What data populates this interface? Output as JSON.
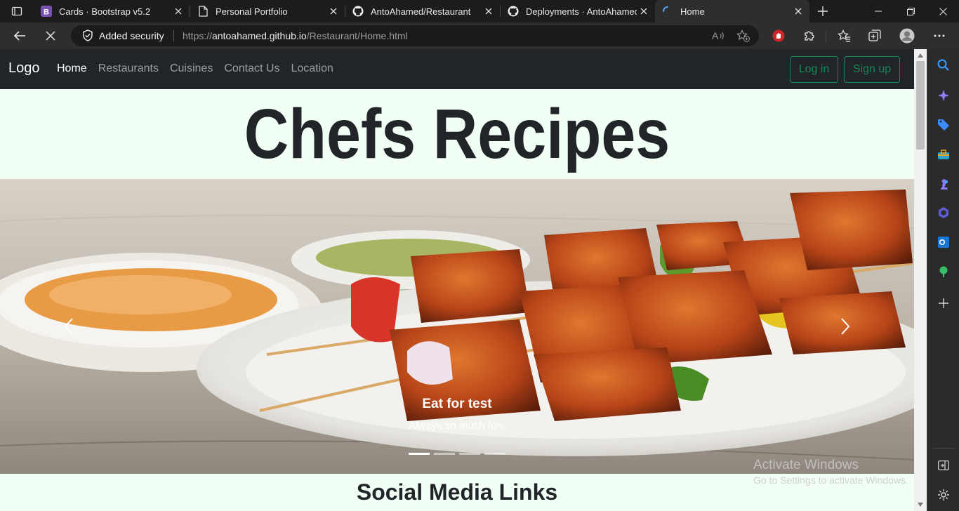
{
  "browser": {
    "tabs": [
      {
        "title": "Cards · Bootstrap v5.2",
        "icon": "bootstrap-icon",
        "active": false
      },
      {
        "title": "Personal Portfolio",
        "icon": "page-icon",
        "active": false
      },
      {
        "title": "AntoAhamed/Restaurant",
        "icon": "github-icon",
        "active": false
      },
      {
        "title": "Deployments · AntoAhamed/",
        "icon": "github-icon",
        "active": false
      },
      {
        "title": "Home",
        "icon": "loading-icon",
        "active": true
      }
    ],
    "security_label": "Added security",
    "url_prefix": "https://",
    "url_host": "antoahamed.github.io",
    "url_path": "/Restaurant/Home.html"
  },
  "navbar": {
    "brand": "Logo",
    "links": [
      "Home",
      "Restaurants",
      "Cuisines",
      "Contact Us",
      "Location"
    ],
    "active_link": "Home",
    "login_label": "Log in",
    "signup_label": "Sign up"
  },
  "hero": {
    "title": "Chefs Recipes"
  },
  "carousel": {
    "caption_title": "Eat for test",
    "caption_text": "Always so much fun.",
    "slide_count": 4,
    "active_slide": 1
  },
  "section": {
    "title": "Social Media Links"
  },
  "watermark": {
    "line1": "Activate Windows",
    "line2": "Go to Settings to activate Windows."
  },
  "colors": {
    "page_bg": "#f1fff4",
    "navbar_bg": "#212529",
    "success": "#198754"
  }
}
